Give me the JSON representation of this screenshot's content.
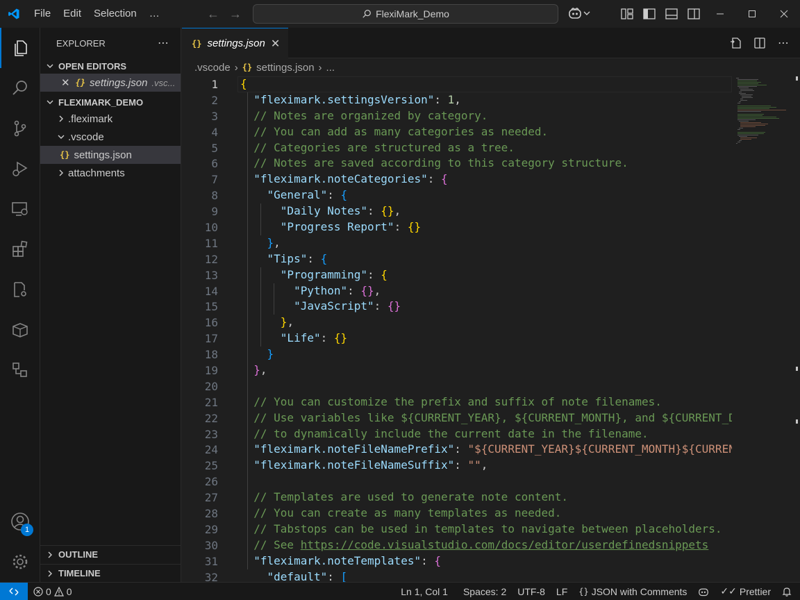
{
  "titlebar": {
    "menu": [
      "File",
      "Edit",
      "Selection"
    ],
    "more": "…",
    "search": "FlexiMark_Demo"
  },
  "activity_badge": "1",
  "explorer": {
    "title": "EXPLORER",
    "open_editors_title": "OPEN EDITORS",
    "open_editor_file": "settings.json",
    "open_editor_folder": ".vsc...",
    "workspace_title": "FLEXIMARK_DEMO",
    "tree": [
      {
        "label": ".fleximark",
        "chevron": "›"
      },
      {
        "label": ".vscode",
        "chevron": "⌄"
      },
      {
        "label": "settings.json",
        "chevron": ""
      },
      {
        "label": "attachments",
        "chevron": "›"
      }
    ],
    "outline": "OUTLINE",
    "timeline": "TIMELINE"
  },
  "editor": {
    "tab_label": "settings.json",
    "breadcrumb": [
      ".vscode",
      "settings.json",
      "..."
    ]
  },
  "code_lines": [
    [
      [
        "{",
        "b1"
      ]
    ],
    [
      [
        "  ",
        "p"
      ],
      [
        "\"fleximark.settingsVersion\"",
        "k"
      ],
      [
        ": ",
        "p"
      ],
      [
        "1",
        "n"
      ],
      [
        ",",
        "p"
      ]
    ],
    [
      [
        "  // Notes are organized by category.",
        "c"
      ]
    ],
    [
      [
        "  // You can add as many categories as needed.",
        "c"
      ]
    ],
    [
      [
        "  // Categories are structured as a tree.",
        "c"
      ]
    ],
    [
      [
        "  // Notes are saved according to this category structure.",
        "c"
      ]
    ],
    [
      [
        "  ",
        "p"
      ],
      [
        "\"fleximark.noteCategories\"",
        "k"
      ],
      [
        ": ",
        "p"
      ],
      [
        "{",
        "b2"
      ]
    ],
    [
      [
        "    ",
        "p"
      ],
      [
        "\"General\"",
        "k"
      ],
      [
        ": ",
        "p"
      ],
      [
        "{",
        "b3"
      ]
    ],
    [
      [
        "      ",
        "p"
      ],
      [
        "\"Daily Notes\"",
        "k"
      ],
      [
        ": ",
        "p"
      ],
      [
        "{}",
        "b1"
      ],
      [
        ",",
        "p"
      ]
    ],
    [
      [
        "      ",
        "p"
      ],
      [
        "\"Progress Report\"",
        "k"
      ],
      [
        ": ",
        "p"
      ],
      [
        "{}",
        "b1"
      ]
    ],
    [
      [
        "    ",
        "p"
      ],
      [
        "}",
        "b3"
      ],
      [
        ",",
        "p"
      ]
    ],
    [
      [
        "    ",
        "p"
      ],
      [
        "\"Tips\"",
        "k"
      ],
      [
        ": ",
        "p"
      ],
      [
        "{",
        "b3"
      ]
    ],
    [
      [
        "      ",
        "p"
      ],
      [
        "\"Programming\"",
        "k"
      ],
      [
        ": ",
        "p"
      ],
      [
        "{",
        "b1"
      ]
    ],
    [
      [
        "        ",
        "p"
      ],
      [
        "\"Python\"",
        "k"
      ],
      [
        ": ",
        "p"
      ],
      [
        "{}",
        "b2"
      ],
      [
        ",",
        "p"
      ]
    ],
    [
      [
        "        ",
        "p"
      ],
      [
        "\"JavaScript\"",
        "k"
      ],
      [
        ": ",
        "p"
      ],
      [
        "{}",
        "b2"
      ]
    ],
    [
      [
        "      ",
        "p"
      ],
      [
        "}",
        "b1"
      ],
      [
        ",",
        "p"
      ]
    ],
    [
      [
        "      ",
        "p"
      ],
      [
        "\"Life\"",
        "k"
      ],
      [
        ": ",
        "p"
      ],
      [
        "{}",
        "b1"
      ]
    ],
    [
      [
        "    ",
        "p"
      ],
      [
        "}",
        "b3"
      ]
    ],
    [
      [
        "  ",
        "p"
      ],
      [
        "}",
        "b2"
      ],
      [
        ",",
        "p"
      ]
    ],
    [],
    [
      [
        "  // You can customize the prefix and suffix of note filenames.",
        "c"
      ]
    ],
    [
      [
        "  // Use variables like ${CURRENT_YEAR}, ${CURRENT_MONTH}, and ${CURRENT_DAY}",
        "c"
      ]
    ],
    [
      [
        "  // to dynamically include the current date in the filename.",
        "c"
      ]
    ],
    [
      [
        "  ",
        "p"
      ],
      [
        "\"fleximark.noteFileNamePrefix\"",
        "k"
      ],
      [
        ": ",
        "p"
      ],
      [
        "\"${CURRENT_YEAR}${CURRENT_MONTH}${CURRENT_DAY}\"",
        "s"
      ]
    ],
    [
      [
        "  ",
        "p"
      ],
      [
        "\"fleximark.noteFileNameSuffix\"",
        "k"
      ],
      [
        ": ",
        "p"
      ],
      [
        "\"\"",
        "s"
      ],
      [
        ",",
        "p"
      ]
    ],
    [],
    [
      [
        "  // Templates are used to generate note content.",
        "c"
      ]
    ],
    [
      [
        "  // You can create as many templates as needed.",
        "c"
      ]
    ],
    [
      [
        "  // Tabstops can be used in templates to navigate between placeholders.",
        "c"
      ]
    ],
    [
      [
        "  // See ",
        "c"
      ],
      [
        "https://code.visualstudio.com/docs/editor/userdefinedsnippets",
        "cu"
      ]
    ],
    [
      [
        "  ",
        "p"
      ],
      [
        "\"fleximark.noteTemplates\"",
        "k"
      ],
      [
        ": ",
        "p"
      ],
      [
        "{",
        "b2"
      ]
    ],
    [
      [
        "    ",
        "p"
      ],
      [
        "\"default\"",
        "k"
      ],
      [
        ": ",
        "p"
      ],
      [
        "[",
        "b3"
      ]
    ]
  ],
  "status": {
    "errors": "0",
    "warnings": "0",
    "position": "Ln 1, Col 1",
    "spaces": "Spaces: 2",
    "encoding": "UTF-8",
    "eol": "LF",
    "language": "JSON with Comments",
    "formatter": "Prettier"
  }
}
